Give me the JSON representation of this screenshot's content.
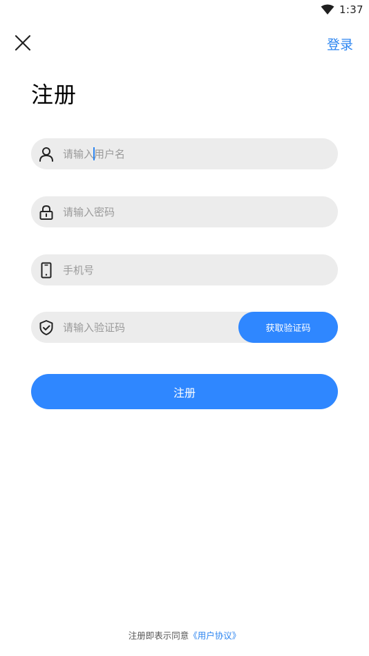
{
  "status_bar": {
    "time": "1:37",
    "wifi_icon": "wifi-icon"
  },
  "header": {
    "close_icon": "close-icon",
    "login_label": "登录"
  },
  "title": "注册",
  "form": {
    "username": {
      "placeholder": "请输入用户名",
      "value": "",
      "icon": "user-icon"
    },
    "password": {
      "placeholder": "请输入密码",
      "value": "",
      "icon": "lock-icon"
    },
    "phone": {
      "placeholder": "手机号",
      "value": "",
      "icon": "phone-icon"
    },
    "code": {
      "placeholder": "请输入验证码",
      "value": "",
      "icon": "shield-check-icon",
      "button_label": "获取验证码"
    }
  },
  "register_button_label": "注册",
  "footer": {
    "prefix": "注册即表示同意",
    "agreement_link": "《用户协议》"
  },
  "colors": {
    "accent": "#2f87ff",
    "link": "#2b84f0",
    "field_bg": "#ececec",
    "placeholder": "#9a9a9a"
  }
}
